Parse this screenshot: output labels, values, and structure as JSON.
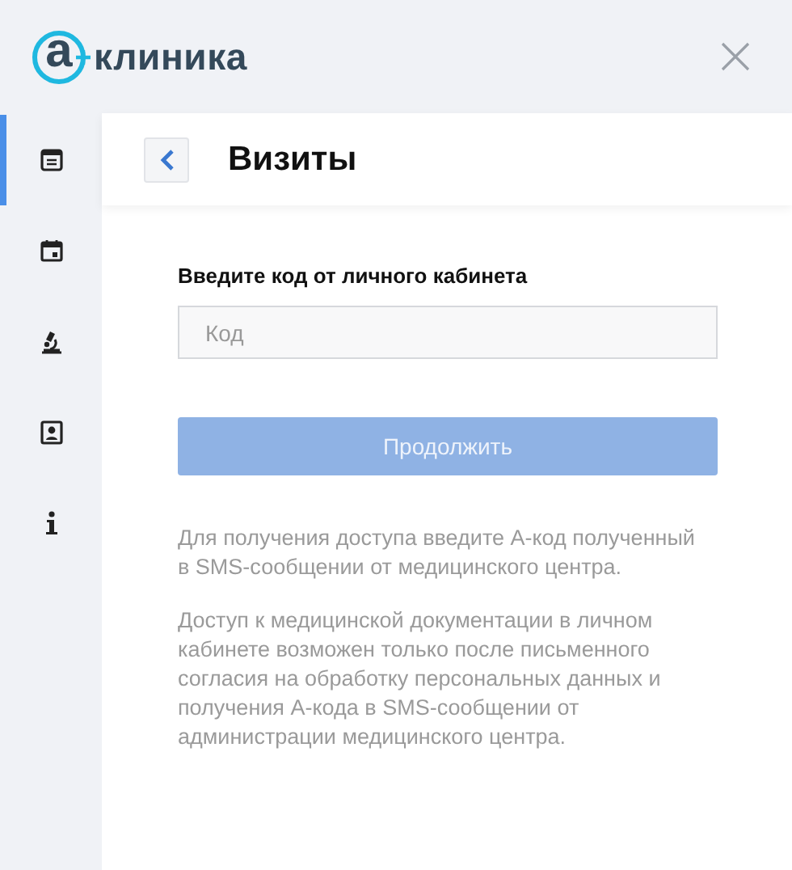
{
  "logo": {
    "letter": "а",
    "name": "клиника"
  },
  "sidebar": {
    "items": [
      {
        "kind": "document",
        "selected": true
      },
      {
        "kind": "calendar",
        "selected": false
      },
      {
        "kind": "microscope",
        "selected": false
      },
      {
        "kind": "badge",
        "selected": false
      },
      {
        "kind": "info",
        "selected": false
      }
    ]
  },
  "page": {
    "title": "Визиты"
  },
  "form": {
    "label": "Введите код от личного кабинета",
    "code_field": {
      "placeholder": "Код"
    },
    "submit_button": {
      "label": "Продолжить",
      "disabled": true
    }
  },
  "notes": [
    "Для получения доступа введите А-код полученный в SMS-сообщении от медицинского центра.",
    "Доступ к медицинской документации в личном кабинете возможен только после письменного согласия на обработку персональных данных и получения А-кода в SMS-сообщении от администрации медицинского центра."
  ]
}
